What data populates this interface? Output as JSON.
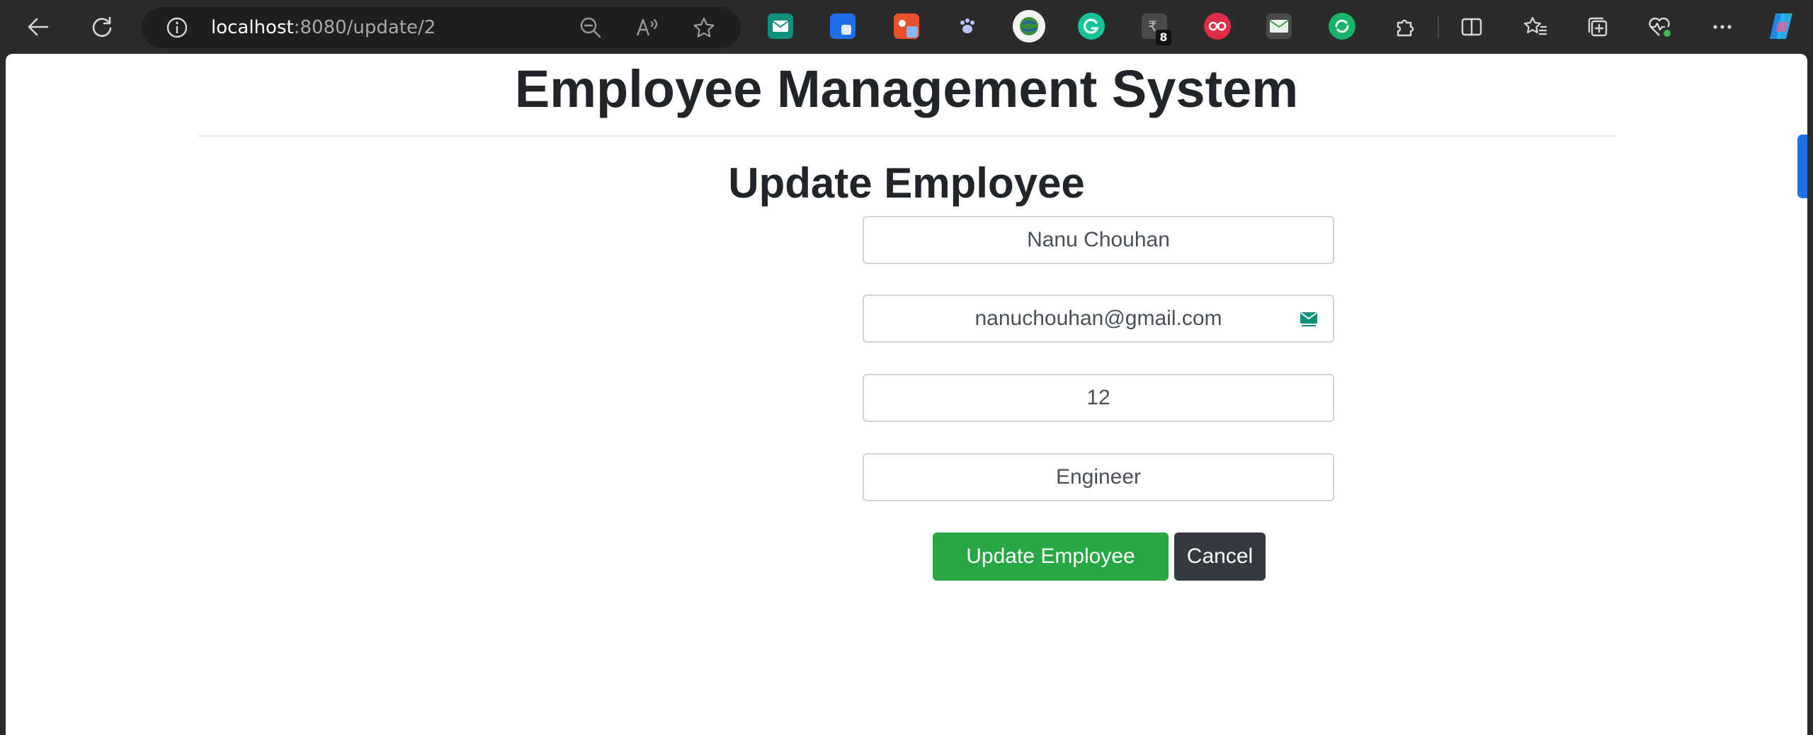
{
  "browser": {
    "url_host": "localhost",
    "url_path": ":8080/update/2",
    "extension_badge": "8",
    "icons": {
      "back": "back-arrow-icon",
      "refresh": "refresh-icon",
      "site_info": "info-icon",
      "zoom": "zoom-out-icon",
      "read_aloud": "read-aloud-icon",
      "favorite": "star-icon",
      "extensions": "puzzle-icon",
      "split_screen": "split-screen-icon",
      "favorites": "favorites-icon",
      "collections": "collections-icon",
      "performance": "heartbeat-icon",
      "more": "more-icon",
      "copilot": "copilot-icon"
    }
  },
  "page": {
    "app_title": "Employee Management System",
    "form_title": "Update Employee",
    "fields": {
      "name": "Nanu Chouhan",
      "email": "nanuchouhan@gmail.com",
      "salary": "12",
      "designation": "Engineer"
    },
    "buttons": {
      "update": "Update Employee",
      "cancel": "Cancel"
    }
  },
  "colors": {
    "primary_button": "#28a745",
    "secondary_button": "#343a40",
    "scroll_accent": "#1a73e8"
  }
}
